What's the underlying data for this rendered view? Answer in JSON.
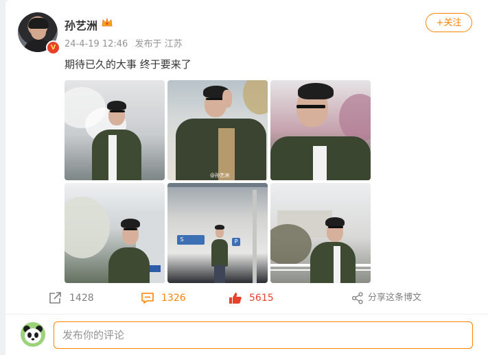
{
  "post": {
    "author": "孙艺洲",
    "verified_badge": "V",
    "timestamp": "24-4-19 12:46",
    "source": "发布于 江苏",
    "follow_label": "+关注",
    "text": "期待已久的大事 终于要来了",
    "photo_watermark": "@孙艺洲",
    "photos": [
      {
        "name": "photo-1"
      },
      {
        "name": "photo-2"
      },
      {
        "name": "photo-3"
      },
      {
        "name": "photo-4"
      },
      {
        "name": "photo-5"
      },
      {
        "name": "photo-6"
      }
    ],
    "signs": {
      "parking_s": "S",
      "parking_p": "P"
    }
  },
  "actions": {
    "repost_count": "1428",
    "comment_count": "1326",
    "like_count": "5615",
    "share_label": "分享这条博文"
  },
  "comment_box": {
    "placeholder": "发布你的评论"
  },
  "colors": {
    "accent": "#ff8200",
    "like": "#e7412b",
    "muted": "#808080"
  },
  "icons": [
    "repost-icon",
    "comment-icon",
    "like-icon",
    "share-icon",
    "crown-icon",
    "verified-icon"
  ]
}
